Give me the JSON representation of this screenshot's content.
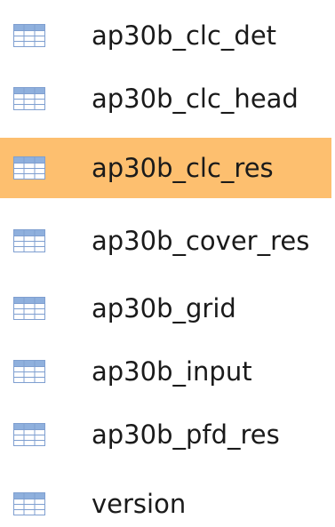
{
  "tables": [
    {
      "label": "ap30b_clc_det",
      "icon": "table-icon",
      "selected": false
    },
    {
      "label": "ap30b_clc_head",
      "icon": "table-icon",
      "selected": false
    },
    {
      "label": "ap30b_clc_res",
      "icon": "table-icon",
      "selected": true
    },
    {
      "label": "ap30b_cover_res",
      "icon": "table-icon",
      "selected": false
    },
    {
      "label": "ap30b_grid",
      "icon": "table-icon",
      "selected": false
    },
    {
      "label": "ap30b_input",
      "icon": "table-icon",
      "selected": false
    },
    {
      "label": "ap30b_pfd_res",
      "icon": "table-icon",
      "selected": false
    },
    {
      "label": "version",
      "icon": "table-icon",
      "selected": false
    }
  ],
  "colors": {
    "selected_bg": "#fdbf6f",
    "icon_header": "#8fb0dd",
    "icon_grid": "#7f9fd0",
    "icon_cell": "#ffffff"
  }
}
